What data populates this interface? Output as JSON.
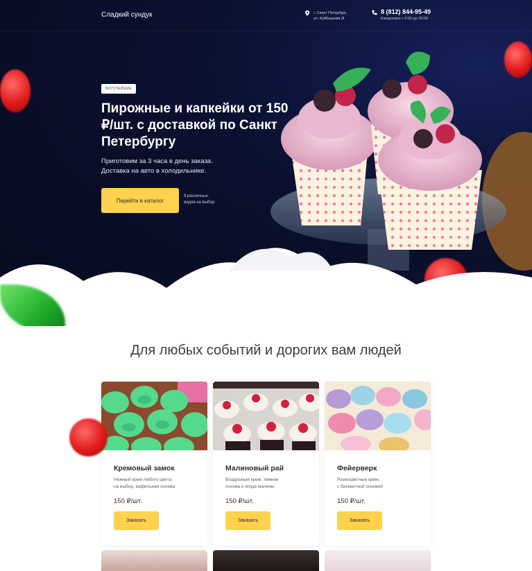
{
  "header": {
    "logo": "Сладкий сундук",
    "address_line1": "г. Санкт Петербург,",
    "address_line2": "ул. Куйбышева 3I",
    "phone": "8 (812) 844-95-49",
    "hours": "Ежедневно с 9:00 до 20:00"
  },
  "hero": {
    "badge": "ВКУСНЕЙШИЕ",
    "title": "Пирожные и капкейки от 150 ₽/шт. с доставкой по Санкт Петербургу",
    "subtitle_line1": "Приготовим за 3 часа в день заказа.",
    "subtitle_line2": "Доставка на авто в холодильнике.",
    "cta_label": "Перейти в каталог",
    "cta_note_line1": "9 различных",
    "cta_note_line2": "видов на выбор"
  },
  "section": {
    "title": "Для любых событий и дорогих вам людей"
  },
  "products": [
    {
      "name": "Кремовый замок",
      "desc_line1": "Нежный крем любого цвета",
      "desc_line2": "на выбор, вафельная основа",
      "price": "150 ₽/шт.",
      "order_label": "Заказать"
    },
    {
      "name": "Малиновый рай",
      "desc_line1": "Воздушный крем, темная",
      "desc_line2": "основа и ягода малины",
      "price": "150 ₽/шт.",
      "order_label": "Заказать"
    },
    {
      "name": "Фейерверк",
      "desc_line1": "Разноцветные крем,",
      "desc_line2": "с бисквитной основой",
      "price": "150 ₽/шт.",
      "order_label": "Заказать"
    }
  ],
  "colors": {
    "accent": "#ffd24d",
    "hero_bg": "#070b1d",
    "text_dark": "#2b2d38"
  },
  "icons": {
    "address": "location-pin-icon",
    "phone": "phone-icon"
  }
}
